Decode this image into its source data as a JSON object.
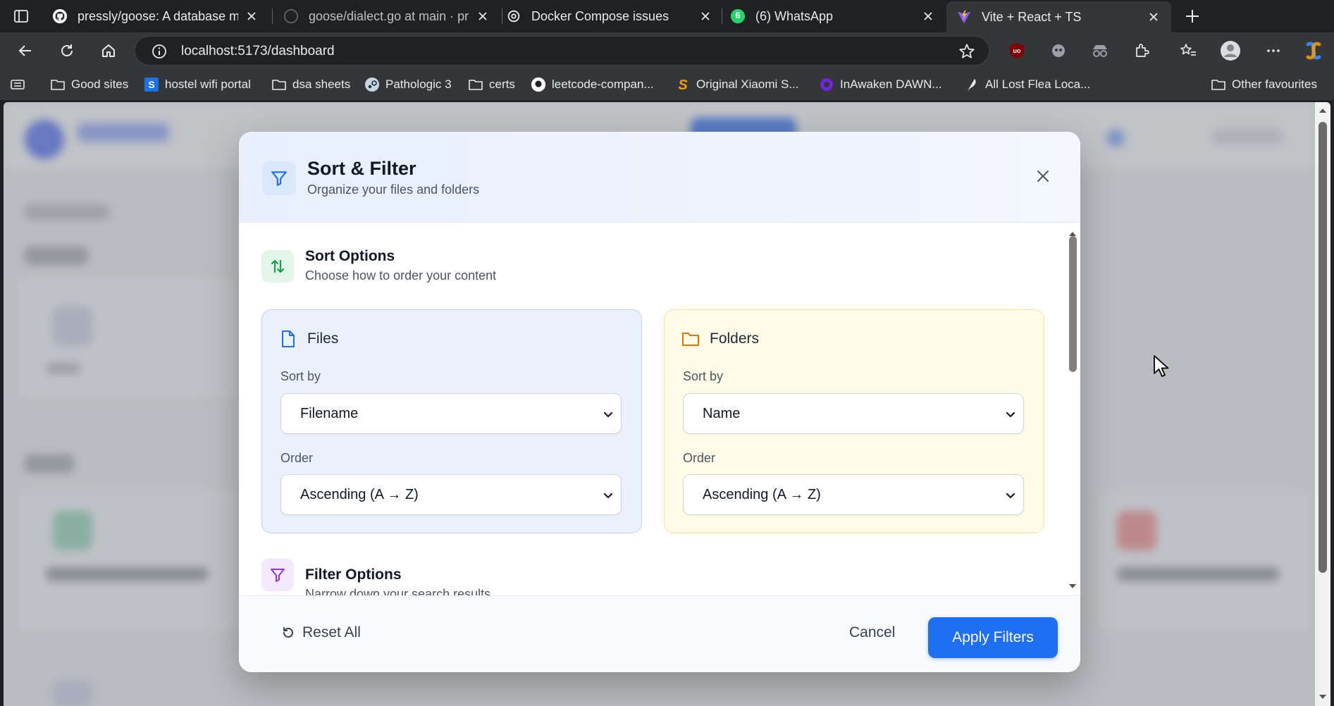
{
  "browser": {
    "tabs": [
      {
        "title": "pressly/goose: A database mig",
        "icon": "github-icon"
      },
      {
        "title": "goose/dialect.go at main · pres",
        "icon": "github-icon"
      },
      {
        "title": "Docker Compose issues",
        "icon": "chatgpt-icon"
      },
      {
        "title": "(6) WhatsApp",
        "icon": "whatsapp-icon",
        "badge": "6"
      },
      {
        "title": "Vite + React + TS",
        "icon": "vite-icon",
        "active": true
      }
    ],
    "url": "localhost:5173/dashboard",
    "bookmarks": [
      {
        "label": "Good sites",
        "icon": "folder-icon"
      },
      {
        "label": "hostel wifi portal",
        "icon": "s-logo-icon"
      },
      {
        "label": "dsa sheets",
        "icon": "folder-icon"
      },
      {
        "label": "Pathologic 3",
        "icon": "steam-icon"
      },
      {
        "label": "certs",
        "icon": "folder-icon"
      },
      {
        "label": "leetcode-compan...",
        "icon": "github-icon"
      },
      {
        "label": "Original Xiaomi S...",
        "icon": "s-brand-icon"
      },
      {
        "label": "InAwaken DAWN...",
        "icon": "dawn-icon"
      },
      {
        "label": "All Lost Flea Loca...",
        "icon": "feather-icon"
      }
    ],
    "other_bookmarks": "Other favourites"
  },
  "modal": {
    "title": "Sort & Filter",
    "subtitle": "Organize your files and folders",
    "sort_section": {
      "title": "Sort Options",
      "description": "Choose how to order your content"
    },
    "files_panel": {
      "title": "Files",
      "sort_by_label": "Sort by",
      "sort_by_value": "Filename",
      "order_label": "Order",
      "order_value": "Ascending (A → Z)"
    },
    "folders_panel": {
      "title": "Folders",
      "sort_by_label": "Sort by",
      "sort_by_value": "Name",
      "order_label": "Order",
      "order_value": "Ascending (A → Z)"
    },
    "filter_section": {
      "title": "Filter Options",
      "description": "Narrow down your search results"
    },
    "footer": {
      "reset_label": "Reset All",
      "cancel_label": "Cancel",
      "apply_label": "Apply Filters"
    }
  },
  "colors": {
    "accent": "#1f6ff2",
    "files_panel_bg": "#eaf1fd",
    "folders_panel_bg": "#fefbe6",
    "sort_icon": "#16a34a",
    "filter_icon": "#9333ea"
  }
}
